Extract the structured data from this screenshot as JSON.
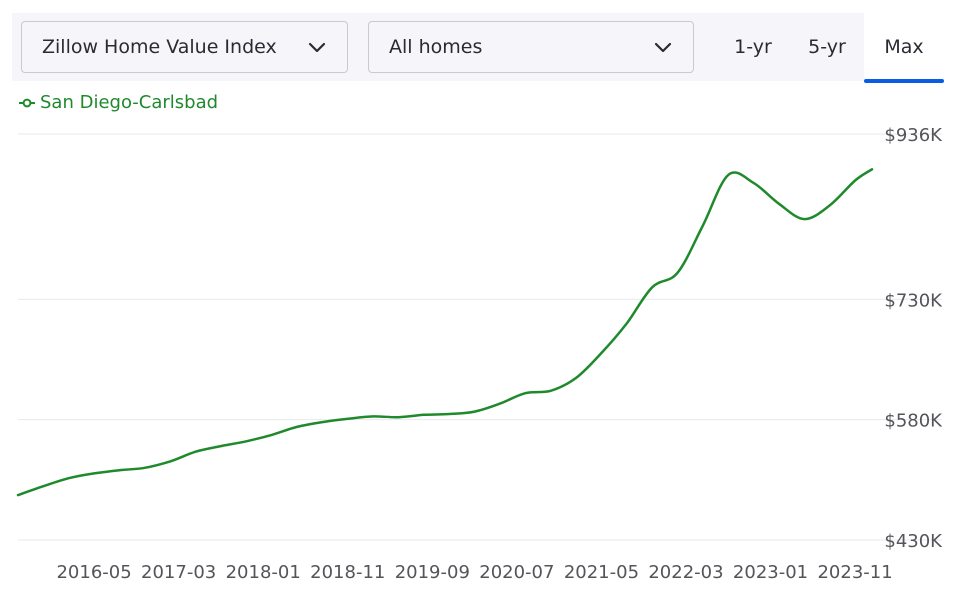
{
  "toolbar": {
    "metric_select": {
      "value": "Zillow Home Value Index",
      "icon": "chevron-down-icon"
    },
    "type_select": {
      "value": "All homes",
      "icon": "chevron-down-icon"
    },
    "range_tabs": [
      {
        "label": "1-yr",
        "active": false
      },
      {
        "label": "5-yr",
        "active": false
      },
      {
        "label": "Max",
        "active": true
      }
    ],
    "active_tab_color": "#0a5ce6"
  },
  "legend": {
    "label": "San Diego-Carlsbad",
    "color": "#1f8a2c"
  },
  "chart_data": {
    "type": "line",
    "series": [
      {
        "name": "San Diego-Carlsbad",
        "color": "#1f8a2c",
        "points": [
          [
            "2015-08",
            486000
          ],
          [
            "2015-11",
            497000
          ],
          [
            "2016-02",
            507000
          ],
          [
            "2016-05",
            513000
          ],
          [
            "2016-08",
            517000
          ],
          [
            "2016-11",
            520000
          ],
          [
            "2017-02",
            528000
          ],
          [
            "2017-05",
            540000
          ],
          [
            "2017-08",
            547000
          ],
          [
            "2017-11",
            553000
          ],
          [
            "2018-02",
            561000
          ],
          [
            "2018-05",
            571000
          ],
          [
            "2018-08",
            577000
          ],
          [
            "2018-11",
            581000
          ],
          [
            "2019-02",
            584000
          ],
          [
            "2019-05",
            583000
          ],
          [
            "2019-08",
            586000
          ],
          [
            "2019-11",
            587000
          ],
          [
            "2020-02",
            590000
          ],
          [
            "2020-05",
            600000
          ],
          [
            "2020-08",
            613000
          ],
          [
            "2020-11",
            616000
          ],
          [
            "2021-02",
            632000
          ],
          [
            "2021-05",
            663000
          ],
          [
            "2021-08",
            700000
          ],
          [
            "2021-11",
            745000
          ],
          [
            "2022-02",
            763000
          ],
          [
            "2022-05",
            822000
          ],
          [
            "2022-08",
            885000
          ],
          [
            "2022-11",
            875000
          ],
          [
            "2023-02",
            849000
          ],
          [
            "2023-05",
            830000
          ],
          [
            "2023-08",
            847000
          ],
          [
            "2023-11",
            878000
          ],
          [
            "2024-01",
            892000
          ]
        ]
      }
    ],
    "x_tick_labels": [
      "2016-05",
      "2017-03",
      "2018-01",
      "2018-11",
      "2019-09",
      "2020-07",
      "2021-05",
      "2022-03",
      "2023-01",
      "2023-11"
    ],
    "y_ticks": [
      {
        "value": 430000,
        "label": "$430K"
      },
      {
        "value": 580000,
        "label": "$580K"
      },
      {
        "value": 730000,
        "label": "$730K"
      },
      {
        "value": 936000,
        "label": "$936K"
      }
    ],
    "ylim": [
      430000,
      936000
    ],
    "xlim": [
      "2015-08",
      "2024-01"
    ],
    "grid": true,
    "legend_position": "top-left"
  }
}
